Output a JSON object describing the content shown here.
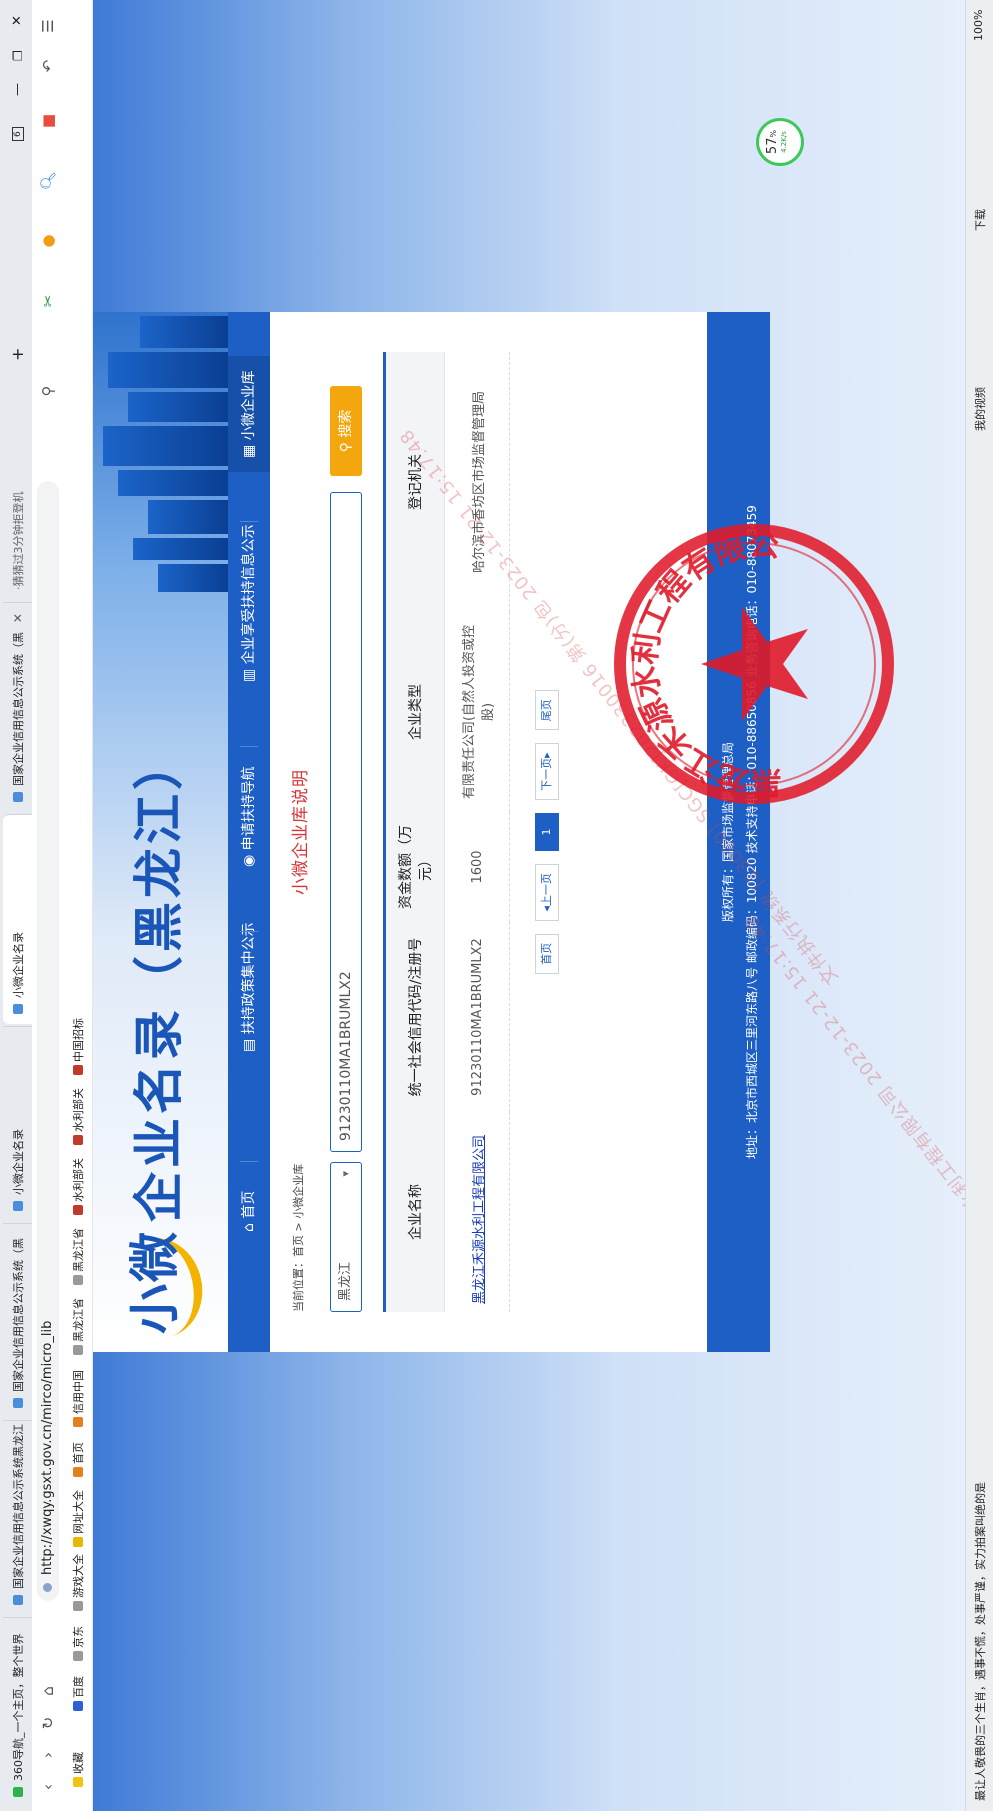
{
  "browser": {
    "tabs": [
      {
        "label": "360导航_一个主页，整个世界"
      },
      {
        "label": "国家企业信用信息公示系统黑龙江（"
      },
      {
        "label": "国家企业信用信息公示系统（黑"
      },
      {
        "label": "小微企业名录"
      },
      {
        "label": "小微企业名录"
      },
      {
        "label": "国家企业信用信息公示系统（黑"
      }
    ],
    "tab_count": "6",
    "url": "http://xwqy.gsxt.gov.cn/mirco/micro_lib",
    "search_hint": "·猜猜过3分钟拒登机",
    "bookmarks": [
      "收藏",
      "百度",
      "京东",
      "游戏大全",
      "网址大全",
      "首页",
      "信用中国",
      "黑龙江省",
      "黑龙江省",
      "水利部关",
      "水利部关",
      "中国招标"
    ],
    "download_label": "下载",
    "zoom": "100%",
    "video_label": "我的视频",
    "status_text": "最让人敬畏的三个生肖，遇事不慌，处事严谨，实力拍案叫绝的是"
  },
  "site": {
    "logo_mark": "小微",
    "logo_title": "企业名录（黑龙江）",
    "nav": [
      "首页",
      "扶持政策集中公示",
      "申请扶持导航",
      "企业享受扶持信息公示",
      "小微企业库"
    ]
  },
  "page": {
    "breadcrumb": "当前位置：首页 > 小微企业库",
    "province": "黑龙江",
    "query": "91230110MA1BRUMLX2",
    "search_label": "搜索",
    "title": "小微企业库说明",
    "columns": [
      "企业名称",
      "统一社会信用代码/注册号",
      "资金数额（万元）",
      "企业类型",
      "登记机关"
    ],
    "rows": [
      {
        "name": "黑龙江禾源水利工程有限公司",
        "code": "91230110MA1BRUMLX2",
        "capital": "1600",
        "type": "有限责任公司(自然人投资或控股)",
        "authority": "哈尔滨市香坊区市场监督管理局"
      }
    ],
    "pager": {
      "first": "首页",
      "prev": "上一页",
      "current": "1",
      "next": "下一页",
      "last": "尾页"
    }
  },
  "footer": {
    "line1": "版权所有：国家市场监督管理总局",
    "line2": "地址：北京市西城区三里河东路八号  邮政编码：100820  技术支持电话：010-88650856  业务咨询电话：010-88073459"
  },
  "watermarks": [
    "黑龙江禾源水利工程有限公司 2023-12-21 15:17:48",
    "文件执行系统 [23000] SGC[GK]202330016 第(分)包 2023-12-21 15:17:48"
  ],
  "seal": {
    "text": "黑龙江禾源水利工程有限公司"
  },
  "widget": {
    "percent": "57",
    "unit": "%",
    "speed": "4.2K/s"
  },
  "colors": {
    "brand_blue": "#1d5fc4",
    "search_orange": "#f4a60e",
    "title_red": "#d63434",
    "seal_red": "#e01a2a"
  }
}
